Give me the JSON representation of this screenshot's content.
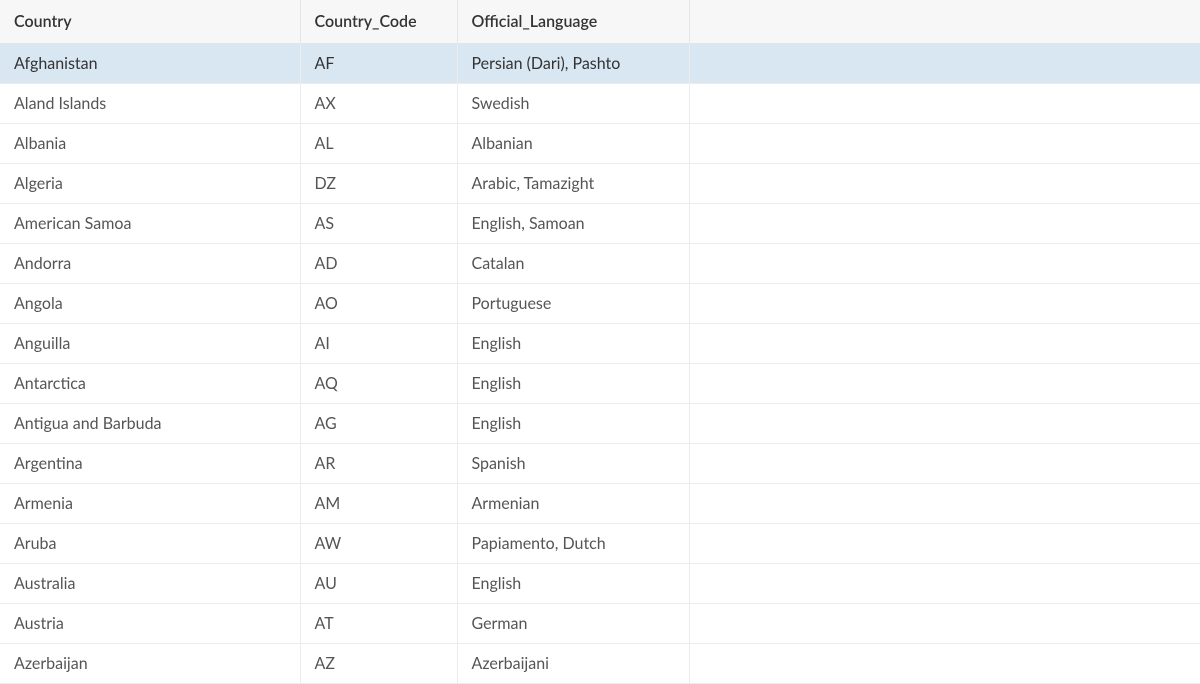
{
  "table": {
    "columns": [
      {
        "key": "country",
        "label": "Country"
      },
      {
        "key": "code",
        "label": "Country_Code"
      },
      {
        "key": "lang",
        "label": "Official_Language"
      },
      {
        "key": "empty",
        "label": ""
      }
    ],
    "rows": [
      {
        "country": "Afghanistan",
        "code": "AF",
        "lang": "Persian (Dari), Pashto",
        "selected": true
      },
      {
        "country": "Aland Islands",
        "code": "AX",
        "lang": "Swedish",
        "selected": false
      },
      {
        "country": "Albania",
        "code": "AL",
        "lang": "Albanian",
        "selected": false
      },
      {
        "country": "Algeria",
        "code": "DZ",
        "lang": "Arabic, Tamazight",
        "selected": false
      },
      {
        "country": "American Samoa",
        "code": "AS",
        "lang": "English, Samoan",
        "selected": false
      },
      {
        "country": "Andorra",
        "code": "AD",
        "lang": "Catalan",
        "selected": false
      },
      {
        "country": "Angola",
        "code": "AO",
        "lang": "Portuguese",
        "selected": false
      },
      {
        "country": "Anguilla",
        "code": "AI",
        "lang": "English",
        "selected": false
      },
      {
        "country": "Antarctica",
        "code": "AQ",
        "lang": "English",
        "selected": false
      },
      {
        "country": "Antigua and Barbuda",
        "code": "AG",
        "lang": "English",
        "selected": false
      },
      {
        "country": "Argentina",
        "code": "AR",
        "lang": "Spanish",
        "selected": false
      },
      {
        "country": "Armenia",
        "code": "AM",
        "lang": "Armenian",
        "selected": false
      },
      {
        "country": "Aruba",
        "code": "AW",
        "lang": "Papiamento, Dutch",
        "selected": false
      },
      {
        "country": "Australia",
        "code": "AU",
        "lang": "English",
        "selected": false
      },
      {
        "country": "Austria",
        "code": "AT",
        "lang": "German",
        "selected": false
      },
      {
        "country": "Azerbaijan",
        "code": "AZ",
        "lang": "Azerbaijani",
        "selected": false
      }
    ]
  }
}
